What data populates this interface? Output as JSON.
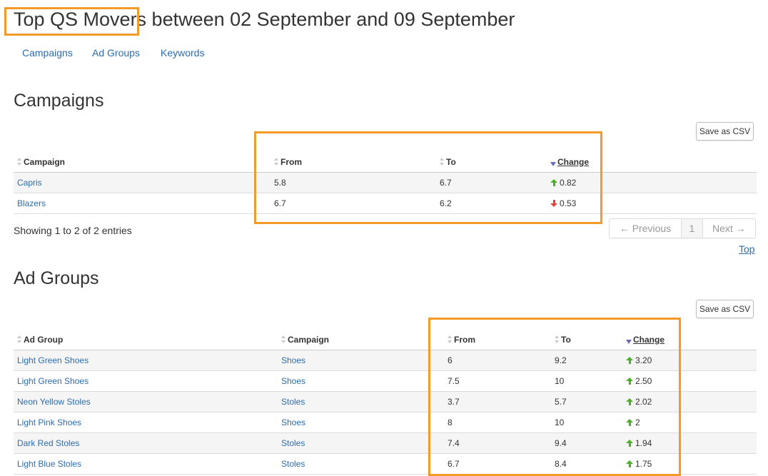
{
  "page": {
    "title": "Top QS Movers between 02 September and 09 September"
  },
  "nav": {
    "items": [
      "Campaigns",
      "Ad Groups",
      "Keywords"
    ]
  },
  "campaigns": {
    "heading": "Campaigns",
    "csv_label": "Save as CSV",
    "columns": [
      "Campaign",
      "From",
      "To",
      "Change"
    ],
    "sorted_column": "Change",
    "rows": [
      {
        "campaign": "Capris",
        "from": "5.8",
        "to": "6.7",
        "change": "0.82",
        "direction": "up"
      },
      {
        "campaign": "Blazers",
        "from": "6.7",
        "to": "6.2",
        "change": "0.53",
        "direction": "down"
      }
    ],
    "info": "Showing 1 to 2 of 2 entries",
    "pagination": {
      "previous": "← Previous",
      "page": "1",
      "next": "Next →"
    },
    "top_link": "Top"
  },
  "ad_groups": {
    "heading": "Ad Groups",
    "csv_label": "Save as CSV",
    "columns": [
      "Ad Group",
      "Campaign",
      "From",
      "To",
      "Change"
    ],
    "sorted_column": "Change",
    "rows": [
      {
        "ad_group": "Light Green Shoes",
        "campaign": "Shoes",
        "from": "6",
        "to": "9.2",
        "change": "3.20",
        "direction": "up"
      },
      {
        "ad_group": "Light Green Shoes",
        "campaign": "Shoes",
        "from": "7.5",
        "to": "10",
        "change": "2.50",
        "direction": "up"
      },
      {
        "ad_group": "Neon Yellow Stoles",
        "campaign": "Stoles",
        "from": "3.7",
        "to": "5.7",
        "change": "2.02",
        "direction": "up"
      },
      {
        "ad_group": "Light Pink Shoes",
        "campaign": "Shoes",
        "from": "8",
        "to": "10",
        "change": "2",
        "direction": "up"
      },
      {
        "ad_group": "Dark Red Stoles",
        "campaign": "Stoles",
        "from": "7.4",
        "to": "9.4",
        "change": "1.94",
        "direction": "up"
      },
      {
        "ad_group": "Light Blue Stoles",
        "campaign": "Stoles",
        "from": "6.7",
        "to": "8.4",
        "change": "1.75",
        "direction": "up"
      }
    ]
  },
  "colors": {
    "link": "#2b6cb0",
    "highlight": "#f39a28",
    "up_arrow": "#4caf2a",
    "down_arrow": "#e0413b"
  }
}
